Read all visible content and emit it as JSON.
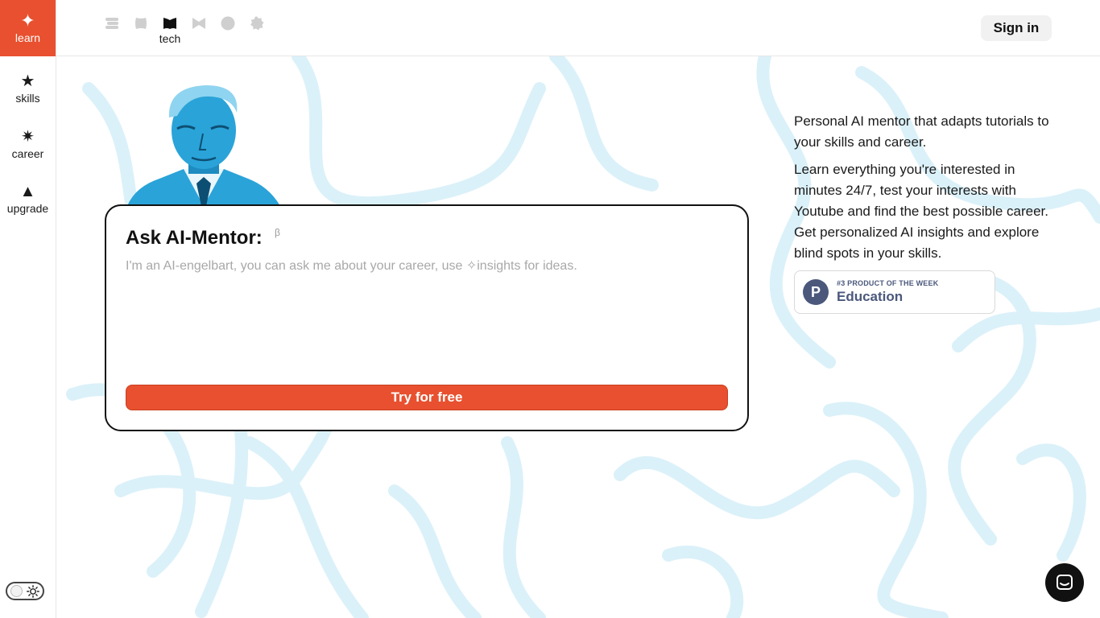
{
  "sidebar": {
    "items": [
      {
        "label": "learn",
        "icon": "sparkle-icon",
        "glyph": "✦",
        "active": true
      },
      {
        "label": "skills",
        "icon": "star-icon",
        "glyph": "★"
      },
      {
        "label": "career",
        "icon": "burst-icon",
        "glyph": "✷"
      },
      {
        "label": "upgrade",
        "icon": "triangle-icon",
        "glyph": "▲"
      }
    ],
    "theme_toggle": {
      "icon": "sun-icon",
      "state": "light"
    }
  },
  "topbar": {
    "tech_tabs": [
      {
        "icon": "layers-icon"
      },
      {
        "icon": "blob-icon"
      },
      {
        "icon": "book-icon",
        "label": "tech",
        "active": true
      },
      {
        "icon": "bowtie-icon"
      },
      {
        "icon": "circle-icon"
      },
      {
        "icon": "gear-icon"
      }
    ],
    "sign_in_label": "Sign in"
  },
  "ask": {
    "title": "Ask AI-Mentor:",
    "beta": "β",
    "placeholder": "I'm an AI-engelbart, you can ask me about your career, use ✧insights for ideas.",
    "value": "",
    "button_label": "Try for free"
  },
  "description": {
    "paragraph1": "Personal AI mentor that adapts tutorials to your skills and career.",
    "paragraph2": "Learn everything you're interested in minutes 24/7, test your interests with Youtube and find the best possible career. Get personalized AI insights and explore blind spots in your skills."
  },
  "product_hunt": {
    "logo_letter": "P",
    "kicker": "#3 PRODUCT OF THE WEEK",
    "category": "Education"
  },
  "chat": {
    "icon": "chat-icon"
  },
  "colors": {
    "accent": "#e8502f",
    "portrait_blue": "#2aa3d8",
    "background_lines": "#d9f0f8",
    "product_hunt": "#4b587c"
  }
}
